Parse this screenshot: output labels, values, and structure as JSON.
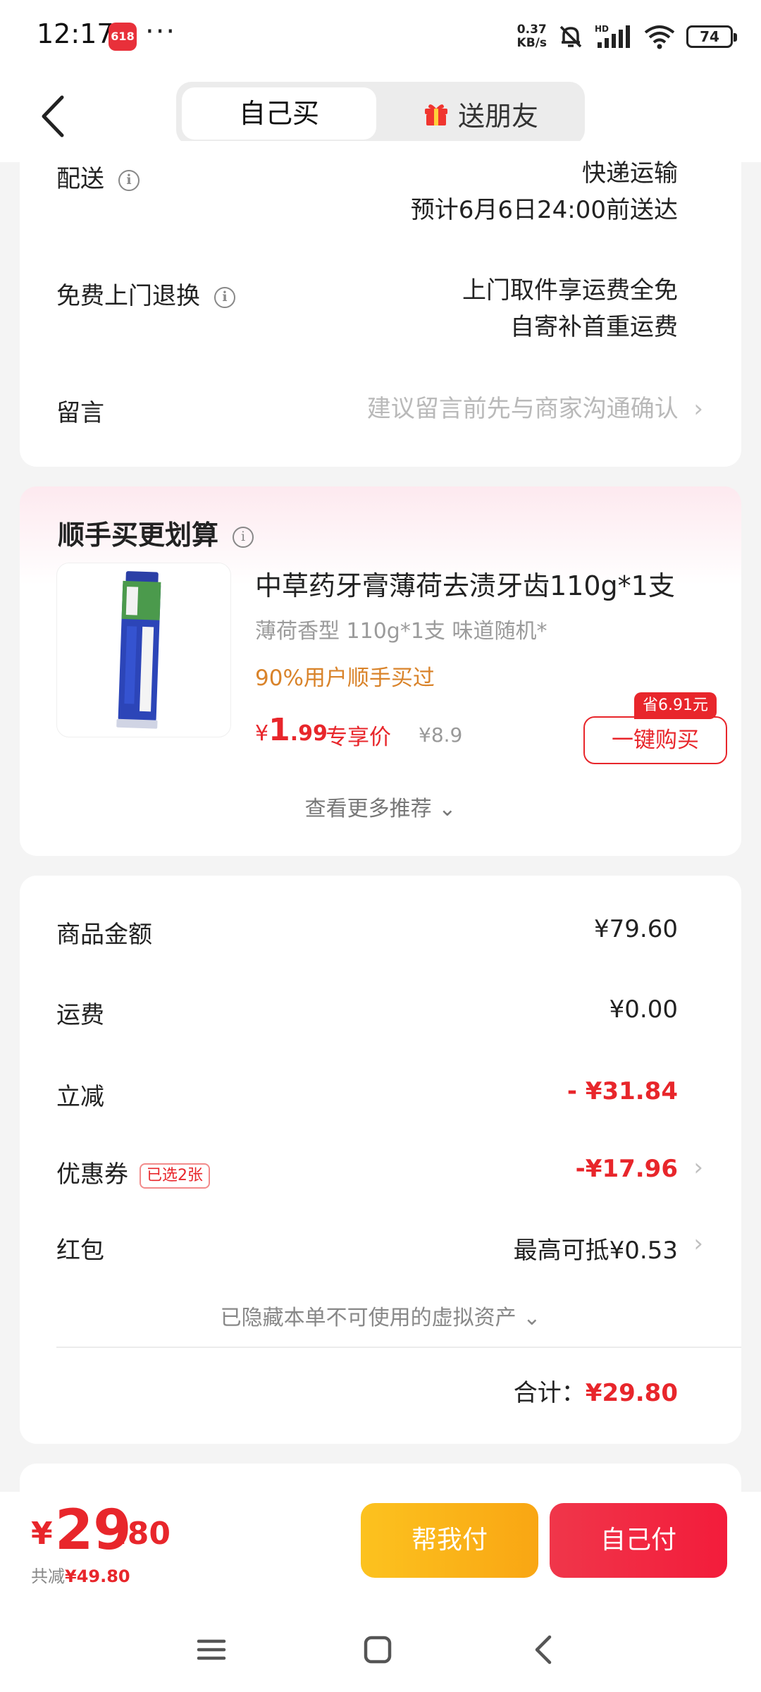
{
  "status_bar": {
    "time": "12:17",
    "app_badge": "618",
    "dots": "···",
    "net_speed_value": "0.37",
    "net_speed_unit": "KB/s",
    "battery": "74"
  },
  "header": {
    "tab_self": "自己买",
    "tab_gift": "送朋友"
  },
  "delivery": {
    "shipping_label": "配送",
    "shipping_method": "快递运输",
    "shipping_eta": "预计6月6日24:00前送达",
    "return_label": "免费上门退换",
    "return_line1": "上门取件享运费全免",
    "return_line2": "自寄补首重运费",
    "note_label": "留言",
    "note_placeholder": "建议留言前先与商家沟通确认"
  },
  "recommend": {
    "title": "顺手买更划算",
    "product_name": "中草药牙膏薄荷去渍牙齿110g*1支",
    "product_spec": "薄荷香型 110g*1支 味道随机*",
    "product_tag": "90%用户顺手买过",
    "price_currency": "¥",
    "price_int": "1",
    "price_dec": ".99",
    "price_label": "专享价",
    "original_price": "¥8.9",
    "save_badge": "省6.91元",
    "buy_button": "一键购买",
    "more_label": "查看更多推荐"
  },
  "price_summary": {
    "goods_label": "商品金额",
    "goods_value": "¥79.60",
    "shipping_label": "运费",
    "shipping_value": "¥0.00",
    "discount_label": "立减",
    "discount_value": "- ¥31.84",
    "coupon_label": "优惠券",
    "coupon_chip": "已选2张",
    "coupon_value": "-¥17.96",
    "redpacket_label": "红包",
    "redpacket_value": "最高可抵¥0.53",
    "hidden_note": "已隐藏本单不可使用的虚拟资产",
    "total_label": "合计：",
    "total_value": "¥29.80"
  },
  "bottom_bar": {
    "currency": "¥",
    "amount_int": "29",
    "amount_dec": ".80",
    "saved_label": "共减",
    "saved_value": "¥49.80",
    "help_pay_button": "帮我付",
    "self_pay_button": "自己付"
  },
  "colors": {
    "accent_red": "#e8262b",
    "accent_orange": "#f9a613",
    "tag_orange": "#d9832a"
  },
  "icons": {
    "back": "back-arrow-icon",
    "gift": "gift-icon",
    "info": "info-icon",
    "chevron": "chevron-right-icon",
    "expand": "chevron-down-icon",
    "nav_menu": "menu-icon",
    "nav_home": "home-square-icon",
    "nav_back": "nav-back-icon"
  }
}
